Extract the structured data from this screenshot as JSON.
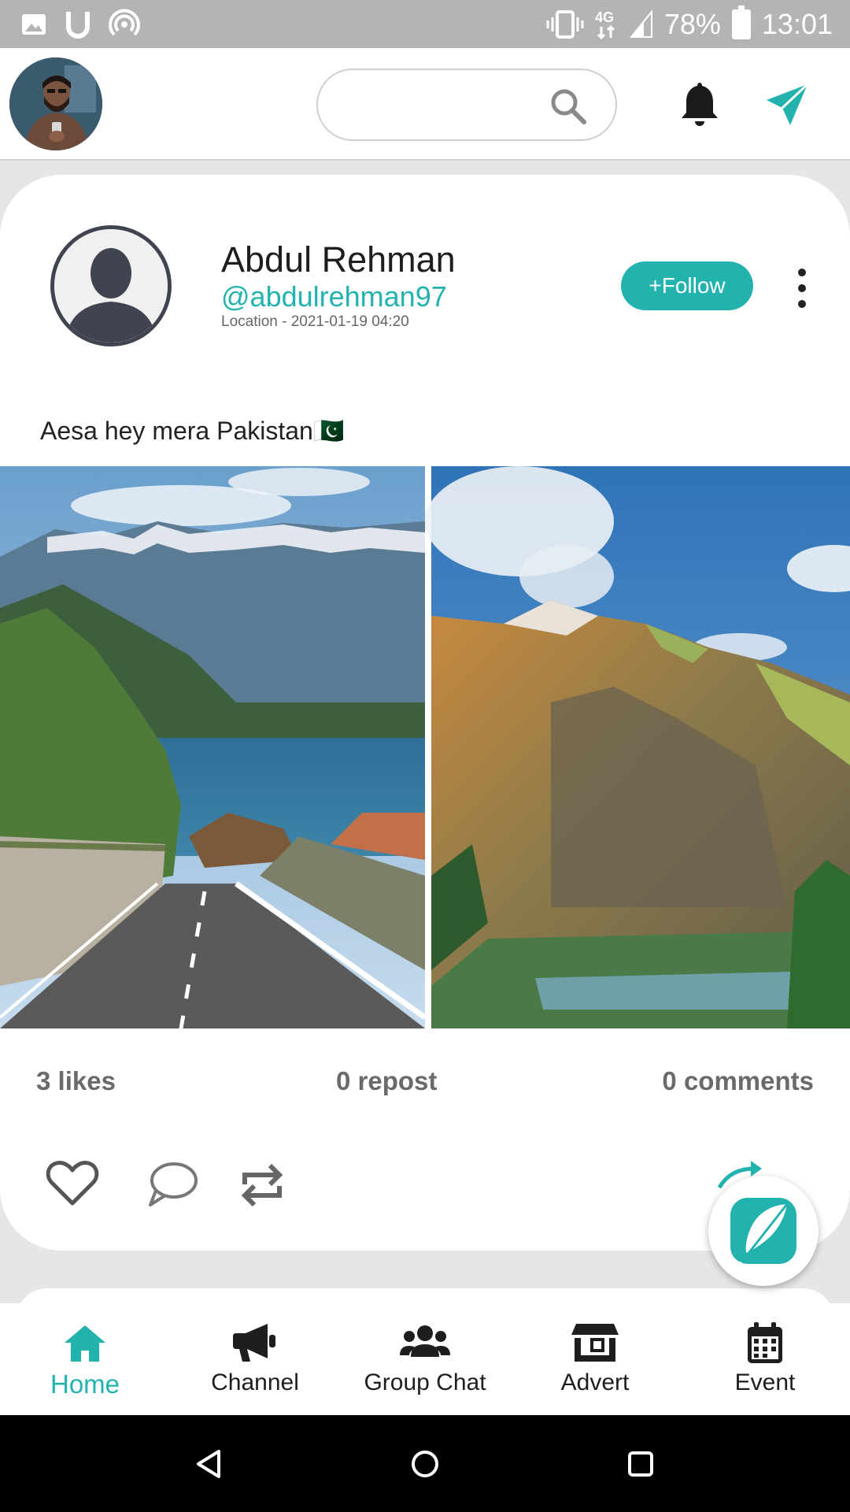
{
  "status_bar": {
    "battery": "78%",
    "time": "13:01",
    "network": "4G"
  },
  "top_bar": {
    "search": {
      "placeholder": "",
      "value": ""
    }
  },
  "post": {
    "author_name": "Abdul Rehman",
    "author_handle": "@abdulrehman97",
    "meta": "Location - 2021-01-19 04:20",
    "follow_label": "+Follow",
    "caption": "Aesa hey mera Pakistan🇵🇰",
    "stats": {
      "likes": "3 likes",
      "reposts": "0 repost",
      "comments": "0 comments"
    }
  },
  "bottom_nav": {
    "items": [
      {
        "label": "Home",
        "icon": "home-icon",
        "active": true
      },
      {
        "label": "Channel",
        "icon": "megaphone-icon",
        "active": false
      },
      {
        "label": "Group Chat",
        "icon": "users-icon",
        "active": false
      },
      {
        "label": "Advert",
        "icon": "store-icon",
        "active": false
      },
      {
        "label": "Event",
        "icon": "calendar-icon",
        "active": false
      }
    ]
  },
  "colors": {
    "accent": "#23b3ae",
    "status_bar": "#b4b4b4",
    "page_background": "#e6e6e6"
  }
}
